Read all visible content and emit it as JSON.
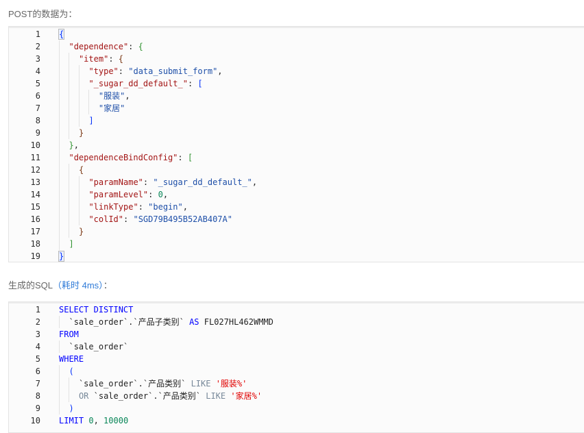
{
  "post_section": {
    "label": "POST的数据为："
  },
  "sql_section": {
    "label_prefix": "生成的SQL",
    "label_accent": "（耗时 4ms）",
    "label_suffix": "："
  },
  "json_editor": {
    "lines": [
      {
        "n": "1",
        "indent": 0,
        "tokens": [
          {
            "c": "t-b1 bracket-hl",
            "t": "{"
          }
        ]
      },
      {
        "n": "2",
        "indent": 1,
        "tokens": [
          {
            "c": "t-key",
            "t": "\"dependence\""
          },
          {
            "c": "t-plain",
            "t": ": "
          },
          {
            "c": "t-b2",
            "t": "{"
          }
        ]
      },
      {
        "n": "3",
        "indent": 2,
        "tokens": [
          {
            "c": "t-key",
            "t": "\"item\""
          },
          {
            "c": "t-plain",
            "t": ": "
          },
          {
            "c": "t-b3",
            "t": "{"
          }
        ]
      },
      {
        "n": "4",
        "indent": 3,
        "tokens": [
          {
            "c": "t-key",
            "t": "\"type\""
          },
          {
            "c": "t-plain",
            "t": ": "
          },
          {
            "c": "t-str",
            "t": "\"data_submit_form\""
          },
          {
            "c": "t-plain",
            "t": ","
          }
        ]
      },
      {
        "n": "5",
        "indent": 3,
        "tokens": [
          {
            "c": "t-key",
            "t": "\"_sugar_dd_default_\""
          },
          {
            "c": "t-plain",
            "t": ": "
          },
          {
            "c": "t-b1",
            "t": "["
          }
        ]
      },
      {
        "n": "6",
        "indent": 4,
        "tokens": [
          {
            "c": "t-str",
            "t": "\"服装\""
          },
          {
            "c": "t-plain",
            "t": ","
          }
        ]
      },
      {
        "n": "7",
        "indent": 4,
        "tokens": [
          {
            "c": "t-str",
            "t": "\"家居\""
          }
        ]
      },
      {
        "n": "8",
        "indent": 3,
        "tokens": [
          {
            "c": "t-b1",
            "t": "]"
          }
        ]
      },
      {
        "n": "9",
        "indent": 2,
        "tokens": [
          {
            "c": "t-b3",
            "t": "}"
          }
        ]
      },
      {
        "n": "10",
        "indent": 1,
        "tokens": [
          {
            "c": "t-b2",
            "t": "}"
          },
          {
            "c": "t-plain",
            "t": ","
          }
        ]
      },
      {
        "n": "11",
        "indent": 1,
        "tokens": [
          {
            "c": "t-key",
            "t": "\"dependenceBindConfig\""
          },
          {
            "c": "t-plain",
            "t": ": "
          },
          {
            "c": "t-b2",
            "t": "["
          }
        ]
      },
      {
        "n": "12",
        "indent": 2,
        "tokens": [
          {
            "c": "t-b3",
            "t": "{"
          }
        ]
      },
      {
        "n": "13",
        "indent": 3,
        "tokens": [
          {
            "c": "t-key",
            "t": "\"paramName\""
          },
          {
            "c": "t-plain",
            "t": ": "
          },
          {
            "c": "t-str",
            "t": "\"_sugar_dd_default_\""
          },
          {
            "c": "t-plain",
            "t": ","
          }
        ]
      },
      {
        "n": "14",
        "indent": 3,
        "tokens": [
          {
            "c": "t-key",
            "t": "\"paramLevel\""
          },
          {
            "c": "t-plain",
            "t": ": "
          },
          {
            "c": "t-num",
            "t": "0"
          },
          {
            "c": "t-plain",
            "t": ","
          }
        ]
      },
      {
        "n": "15",
        "indent": 3,
        "tokens": [
          {
            "c": "t-key",
            "t": "\"linkType\""
          },
          {
            "c": "t-plain",
            "t": ": "
          },
          {
            "c": "t-str",
            "t": "\"begin\""
          },
          {
            "c": "t-plain",
            "t": ","
          }
        ]
      },
      {
        "n": "16",
        "indent": 3,
        "tokens": [
          {
            "c": "t-key",
            "t": "\"colId\""
          },
          {
            "c": "t-plain",
            "t": ": "
          },
          {
            "c": "t-str",
            "t": "\"SGD79B495B52AB407A\""
          }
        ]
      },
      {
        "n": "17",
        "indent": 2,
        "tokens": [
          {
            "c": "t-b3",
            "t": "}"
          }
        ]
      },
      {
        "n": "18",
        "indent": 1,
        "tokens": [
          {
            "c": "t-b2",
            "t": "]"
          }
        ]
      },
      {
        "n": "19",
        "indent": 0,
        "tokens": [
          {
            "c": "t-b1 bracket-hl",
            "t": "}"
          }
        ]
      }
    ]
  },
  "sql_editor": {
    "lines": [
      {
        "n": "1",
        "indent": 0,
        "tokens": [
          {
            "c": "t-kw",
            "t": "SELECT DISTINCT"
          }
        ]
      },
      {
        "n": "2",
        "indent": 1,
        "tokens": [
          {
            "c": "t-plain",
            "t": "`sale_order`.`产品子类别` "
          },
          {
            "c": "t-kw",
            "t": "AS"
          },
          {
            "c": "t-plain",
            "t": " FL027HL462WMMD"
          }
        ]
      },
      {
        "n": "3",
        "indent": 0,
        "tokens": [
          {
            "c": "t-kw",
            "t": "FROM"
          }
        ]
      },
      {
        "n": "4",
        "indent": 1,
        "tokens": [
          {
            "c": "t-plain",
            "t": "`sale_order`"
          }
        ]
      },
      {
        "n": "5",
        "indent": 0,
        "tokens": [
          {
            "c": "t-kw",
            "t": "WHERE"
          }
        ]
      },
      {
        "n": "6",
        "indent": 1,
        "tokens": [
          {
            "c": "t-b1",
            "t": "("
          }
        ]
      },
      {
        "n": "7",
        "indent": 2,
        "tokens": [
          {
            "c": "t-plain",
            "t": "`sale_order`.`产品类别` "
          },
          {
            "c": "t-op",
            "t": "LIKE"
          },
          {
            "c": "t-plain",
            "t": " "
          },
          {
            "c": "t-sstr",
            "t": "'服装%'"
          }
        ]
      },
      {
        "n": "8",
        "indent": 2,
        "tokens": [
          {
            "c": "t-op",
            "t": "OR"
          },
          {
            "c": "t-plain",
            "t": " `sale_order`.`产品类别` "
          },
          {
            "c": "t-op",
            "t": "LIKE"
          },
          {
            "c": "t-plain",
            "t": " "
          },
          {
            "c": "t-sstr",
            "t": "'家居%'"
          }
        ]
      },
      {
        "n": "9",
        "indent": 1,
        "tokens": [
          {
            "c": "t-b1",
            "t": ")"
          }
        ]
      },
      {
        "n": "10",
        "indent": 0,
        "tokens": [
          {
            "c": "t-kw",
            "t": "LIMIT"
          },
          {
            "c": "t-plain",
            "t": " "
          },
          {
            "c": "t-num",
            "t": "0"
          },
          {
            "c": "t-plain",
            "t": ", "
          },
          {
            "c": "t-num",
            "t": "10000"
          }
        ]
      }
    ]
  }
}
